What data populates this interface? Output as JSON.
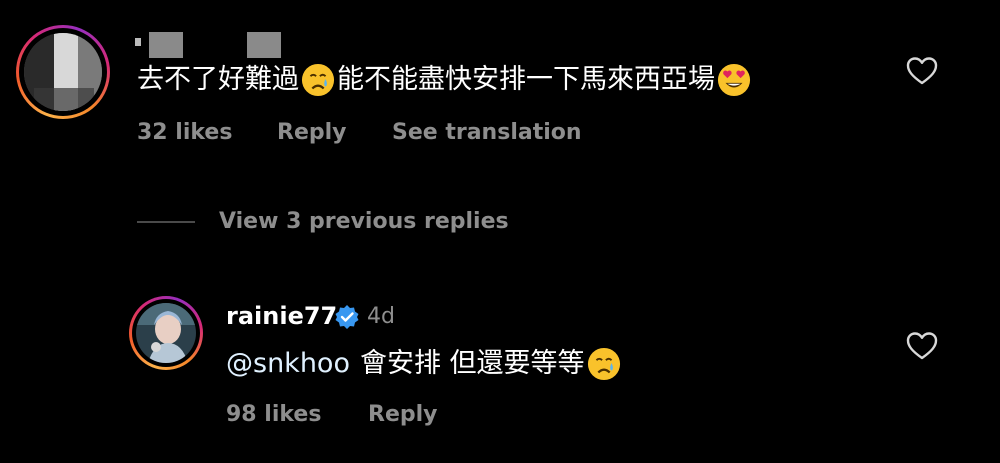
{
  "colors": {
    "background": "#000000",
    "text": "#ffffff",
    "muted": "#8e8e8e",
    "verified": "#3897f0",
    "mention": "#e0f1ff"
  },
  "comment1": {
    "text_part1": "去不了好難過",
    "emoji1": "crying-face",
    "text_part2": "能不能盡快安排一下馬來西亞場",
    "emoji2": "heart-eyes-face",
    "likes": "32 likes",
    "reply": "Reply",
    "translate": "See translation",
    "like_icon": "heart-outline-icon"
  },
  "replies_toggle": {
    "label": "View 3 previous replies"
  },
  "comment2": {
    "username": "rainie77",
    "verified_icon": "verified-badge-icon",
    "time": "4d",
    "mention": "@snkhoo",
    "text": "會安排 但還要等等",
    "emoji": "crying-face",
    "likes": "98 likes",
    "reply": "Reply",
    "like_icon": "heart-outline-icon"
  }
}
